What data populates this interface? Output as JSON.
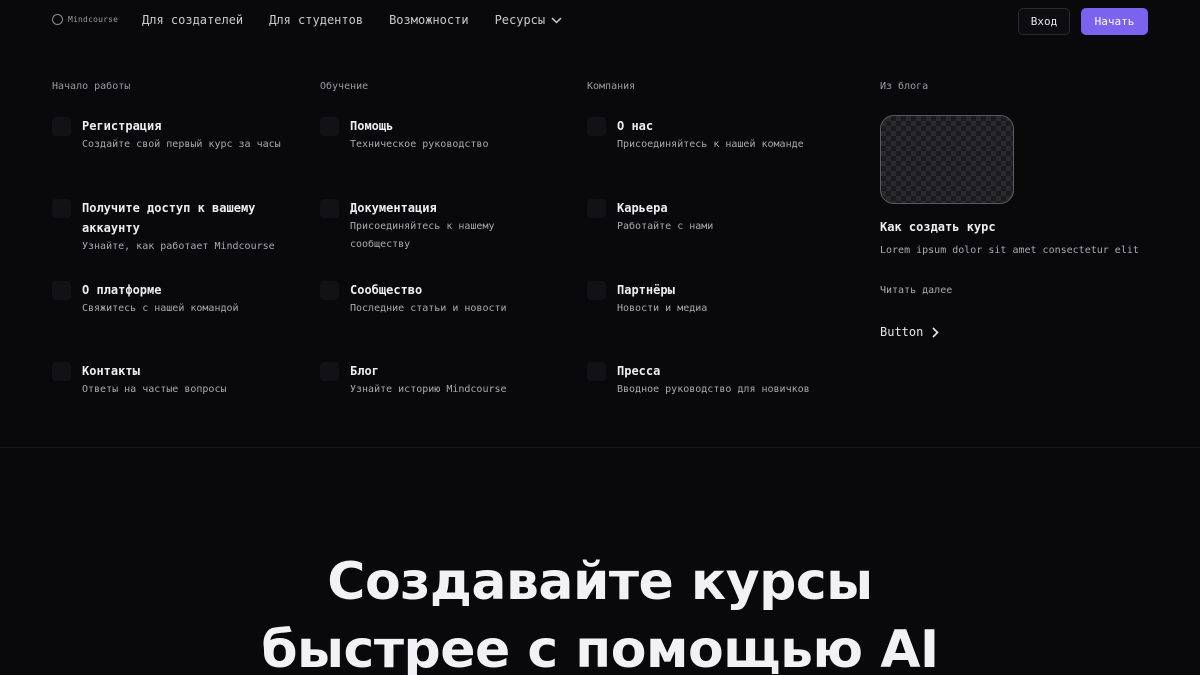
{
  "nav": {
    "logo_text": "Mindcourse",
    "links": [
      "Для создателей",
      "Для студентов",
      "Возможности",
      "Ресурсы"
    ],
    "login_label": "Вход",
    "start_label": "Начать"
  },
  "menu": {
    "columns": [
      {
        "title": "Начало работы",
        "items": [
          {
            "title": "Регистрация",
            "desc": "Создайте свой первый курс за часы"
          },
          {
            "title": "Получите доступ к вашему аккаунту",
            "desc": "Узнайте, как работает Mindcourse"
          },
          {
            "title": "О платформе",
            "desc": "Свяжитесь с нашей командой"
          },
          {
            "title": "Контакты",
            "desc": "Ответы на частые вопросы"
          }
        ]
      },
      {
        "title": "Обучение",
        "items": [
          {
            "title": "Помощь",
            "desc": "Техническое руководство"
          },
          {
            "title": "Документация",
            "desc": "Присоединяйтесь к нашему сообществу"
          },
          {
            "title": "Сообщество",
            "desc": "Последние статьи и новости"
          },
          {
            "title": "Блог",
            "desc": "Узнайте историю Mindcourse"
          }
        ]
      },
      {
        "title": "Компания",
        "items": [
          {
            "title": "О нас",
            "desc": "Присоединяйтесь к нашей команде"
          },
          {
            "title": "Карьера",
            "desc": "Работайте с нами"
          },
          {
            "title": "Партнёры",
            "desc": "Новости и медиа"
          },
          {
            "title": "Пресса",
            "desc": "Вводное руководство для новичков"
          }
        ]
      }
    ],
    "blog": {
      "section_title": "Из блога",
      "post_title": "Как создать курс",
      "post_desc": "Lorem ipsum dolor sit amet consectetur elit",
      "read_more": "Читать далее",
      "button_label": "Button"
    }
  },
  "hero": {
    "line1": "Создавайте курсы",
    "line2": "быстрее с помощью AI"
  },
  "colors": {
    "background": "#09080b",
    "accent": "#7b63f0"
  }
}
